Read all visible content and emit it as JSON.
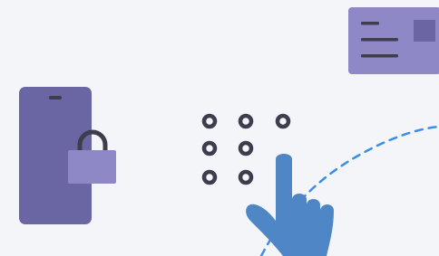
{
  "illustration": {
    "colors": {
      "background": "#f4f5f9",
      "phone": "#6a66a3",
      "phone_speaker": "#3d3d4e",
      "lock_body": "#8e88c6",
      "lock_shackle": "#3d3d4e",
      "card": "#8e88c6",
      "card_lines": "#3d3d4e",
      "card_chip": "#6a66a3",
      "pin_dots": "#3d3d4e",
      "hand": "#4e86c6",
      "dashed_path": "#3b8ee8"
    },
    "icons": [
      "smartphone-icon",
      "padlock-icon",
      "id-card-icon",
      "pin-pad-icon",
      "pointing-hand-icon"
    ]
  }
}
